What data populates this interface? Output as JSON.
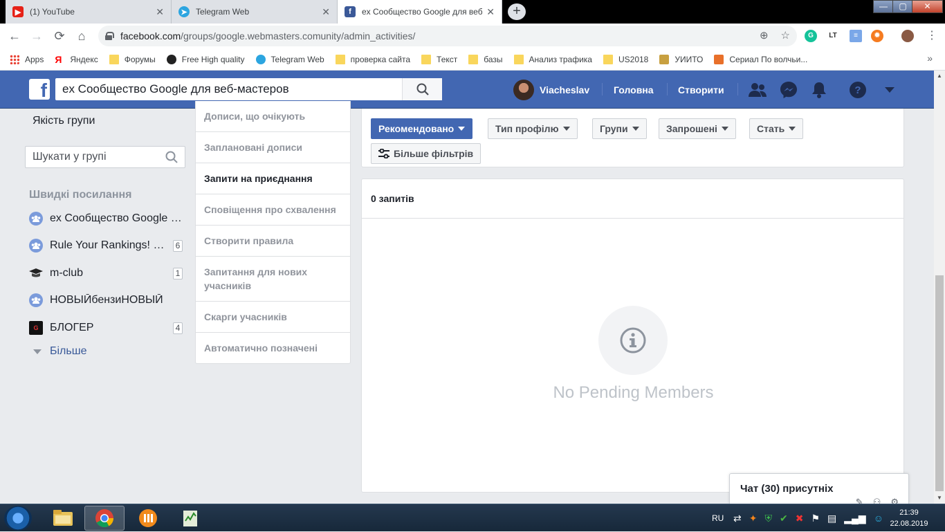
{
  "browser": {
    "tabs": [
      {
        "title": "(1) YouTube",
        "icon": "youtube-icon",
        "active": false
      },
      {
        "title": "Telegram Web",
        "icon": "telegram-icon",
        "active": false
      },
      {
        "title": "ex Сообщество Google для веб",
        "icon": "facebook-icon",
        "active": true
      }
    ],
    "window_controls": {
      "minimize": "—",
      "maximize": "▢",
      "close": "✕"
    },
    "url_host": "facebook.com",
    "url_path": "/groups/google.webmasters.comunity/admin_activities/",
    "bookmarks": [
      {
        "label": "Apps",
        "icon": "apps-grid-icon"
      },
      {
        "label": "Яндекс",
        "icon": "yandex-icon"
      },
      {
        "label": "Форумы",
        "icon": "folder-icon"
      },
      {
        "label": "Free High quality",
        "icon": "site-icon"
      },
      {
        "label": "Telegram Web",
        "icon": "telegram-icon"
      },
      {
        "label": "проверка сайта",
        "icon": "folder-icon"
      },
      {
        "label": "Текст",
        "icon": "folder-icon"
      },
      {
        "label": "базы",
        "icon": "folder-icon"
      },
      {
        "label": "Анализ трафика",
        "icon": "folder-icon"
      },
      {
        "label": "US2018",
        "icon": "folder-icon"
      },
      {
        "label": "УИИТО",
        "icon": "site-icon"
      },
      {
        "label": "Сериал По волчьи...",
        "icon": "site-icon"
      }
    ],
    "bookmarks_overflow": "»"
  },
  "fb": {
    "search_value": "ex Сообщество Google для веб-мастеров",
    "user_name": "Viacheslav",
    "nav_home": "Головна",
    "nav_create": "Створити"
  },
  "left": {
    "quality": "Якість групи",
    "group_search_placeholder": "Шукати у групі",
    "quick_links_title": "Швидкі посилання",
    "quick_links": [
      {
        "label": "ex Сообщество Google для веб-мастеров",
        "badge": ""
      },
      {
        "label": "Rule Your Rankings! SEO & Digital Marketing",
        "badge": "6"
      },
      {
        "label": "m-club",
        "badge": "1"
      },
      {
        "label": "НОВЫЙбензиНОВЫЙ",
        "badge": ""
      },
      {
        "label": "БЛОГЕР",
        "badge": "4"
      }
    ],
    "more": "Більше"
  },
  "menu": {
    "items": [
      "Дописи, що очікують",
      "Заплановані дописи",
      "Запити на приєднання",
      "Сповіщення про схвалення",
      "Створити правила",
      "Запитання для нових учасників",
      "Скарги учасників",
      "Автоматично позначені"
    ],
    "active_index": 2
  },
  "filters": {
    "recommended": "Рекомендовано",
    "profile_type": "Тип профілю",
    "groups": "Групи",
    "invited": "Запрошені",
    "gender": "Стать",
    "more_filters": "Більше фільтрів"
  },
  "results": {
    "count_label": "0 запитів",
    "empty_text": "No Pending Members"
  },
  "chat": {
    "title": "Чат (30) присутніх"
  },
  "taskbar": {
    "lang": "RU",
    "time": "21:39",
    "date": "22.08.2019"
  },
  "colors": {
    "fb_blue": "#4267b2",
    "fb_link": "#385898",
    "page_bg": "#e9ebee",
    "muted_text": "#90949c"
  }
}
